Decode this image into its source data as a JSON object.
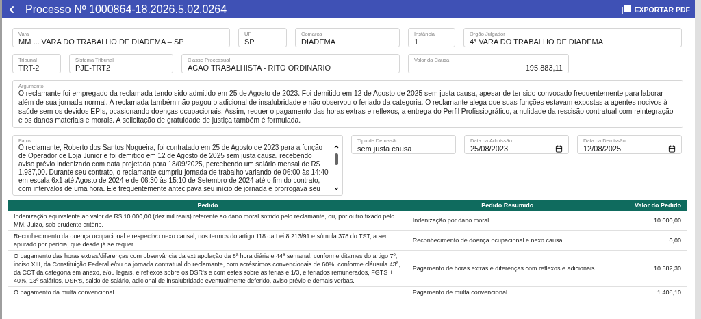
{
  "header": {
    "title": "Processo Nº 1000864-18.2026.5.02.0264",
    "export_button": "EXPORTAR PDF"
  },
  "fields_row_1": [
    {
      "label": "Vara",
      "value": "MM ... VARA DO TRABALHO DE DIADEMA – SP"
    },
    {
      "label": "UF",
      "value": "SP"
    },
    {
      "label": "Comarca",
      "value": "DIADEMA"
    },
    {
      "label": "Instância",
      "value": "1"
    },
    {
      "label": "Orgão Julgador",
      "value": "4ª VARA DO TRABALHO DE DIADEMA"
    }
  ],
  "fields_row_2": [
    {
      "label": "Tribunal",
      "value": "TRT-2"
    },
    {
      "label": "Sistema Tribunal",
      "value": "PJE-TRT2"
    },
    {
      "label": "Classe Processual",
      "value": "ACAO TRABALHISTA - RITO ORDINARIO"
    },
    {
      "label": "Valor da Causa",
      "value": "195.883,11"
    }
  ],
  "argumento": {
    "label": "Argumento",
    "value": "O reclamante foi empregado da reclamada tendo sido admitido em 25 de Agosto de 2023. Foi demitido em 12 de Agosto de 2025 sem justa causa, apesar de ter sido convocado frequentemente para laborar além de sua jornada normal. A reclamada também não pagou o adicional de insalubridade e não observou o feriado da categoria. O reclamante alega que suas funções estavam expostas a agentes nocivos à saúde sem os devidos EPIs, ocasionando doenças ocupacionais. Assim, requer o pagamento das horas extras e reflexos, a entrega do Perfil Profissiográfico, a nulidade da rescisão contratual com reintegração e os danos materiais e morais. A solicitação de gratuidade de justiça também é formulada."
  },
  "fatos": {
    "label": "Fatos",
    "value": "O reclamante, Roberto dos Santos Nogueira, foi contratado em 25 de Agosto de 2023 para a função de Operador de Loja Junior e foi demitido em 12 de Agosto de 2025 sem justa causa, recebendo aviso prévio indenizado com data projetada para 18/09/2025, percebendo um salário mensal de R$ 1.987,00. Durante seu contrato, o reclamante cumpriu jornada de trabalho variando de 06:00 às 14:40 em escala 6x1 até Agosto de 2024 e de 06:30 às 15:10 de Setembro de 2024 até o fim do contrato, com intervalos de uma hora. Ele frequentemente antecipava seu início de jornada e prorrogava seu"
  },
  "side_fields": [
    {
      "kind": "text",
      "label": "Tipo de Demissão",
      "value": "sem justa causa"
    },
    {
      "kind": "date",
      "label": "Data da Admissão",
      "value": "25/08/2023"
    },
    {
      "kind": "date",
      "label": "Data da Demissão",
      "value": "12/08/2025"
    }
  ],
  "table": {
    "columns": [
      "Pedido",
      "Pedido Resumido",
      "Valor do Pedido"
    ],
    "rows": [
      [
        "Indenização equivalente ao valor de R$ 10.000,00 (dez mil reais) referente ao dano moral sofrido pelo reclamante, ou, por outro fixado pelo MM. Juízo, sob prudente critério.",
        "Indenização por dano moral.",
        "10.000,00"
      ],
      [
        "Reconhecimento da doença ocupacional e respectivo nexo causal, nos termos do artigo 118 da Lei 8.213/91 e súmula 378 do TST, a ser apurado por perícia, que desde já se requer.",
        "Reconhecimento de doença ocupacional e nexo causal.",
        "0,00"
      ],
      [
        "O pagamento das horas extras/diferenças com observância da extrapolação da 8ª hora diária e 44ª semanal, conforme ditames do artigo 7º, inciso XIII, da Constituição Federal e/ou da jornada contratual do reclamante, com acréscimos convencionais de 60%, conforme cláusula 43ª, da CCT da categoria em anexo, e/ou legais, e reflexos sobre os DSR's e com estes sobre as férias e 1/3, e feriados remunerados, FGTS + 40%, 13º salários, DSR's, saldo de salário, adicional de insalubridade eventualmente deferido, aviso prévio e demais verbas.",
        "Pagamento de horas extras e diferenças com reflexos e adicionais.",
        "10.582,30"
      ],
      [
        "O pagamento da multa convencional.",
        "Pagamento de multa convencional.",
        "1.408,10"
      ]
    ]
  }
}
